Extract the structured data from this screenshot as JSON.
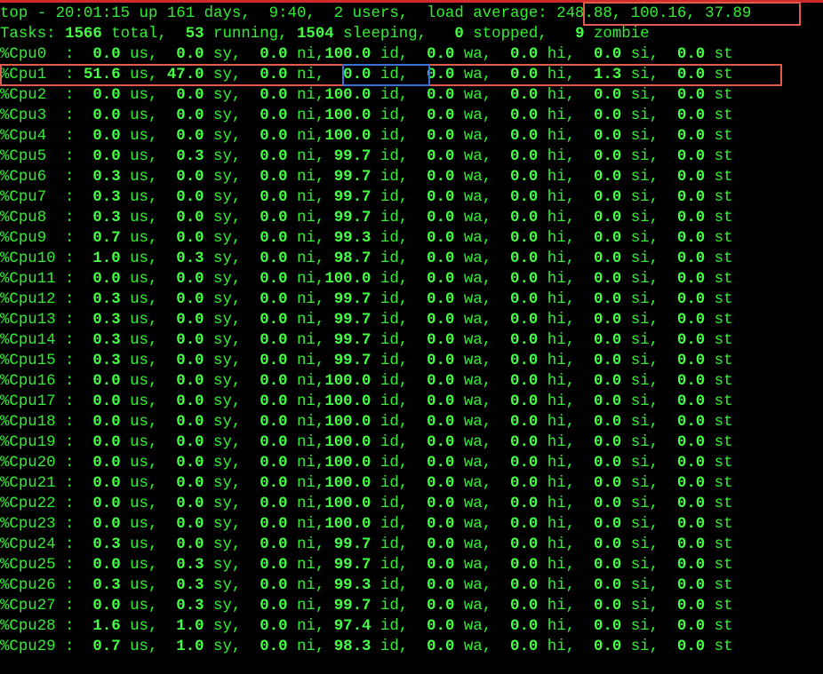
{
  "terminal": {
    "summary_top": {
      "prefix": "top - 20:01:15 up 161 days,  9:40,  2 users,  load average: ",
      "load_average": "248.88, 100.16, 37.89"
    },
    "tasks": {
      "label": "Tasks: ",
      "total": "1566",
      "total_label": " total,  ",
      "running": "53",
      "running_label": " running, ",
      "sleeping": "1504",
      "sleeping_label": " sleeping,   ",
      "stopped": "0",
      "stopped_label": " stopped,   ",
      "zombie": "9",
      "zombie_label": " zombie"
    },
    "cpus": [
      {
        "name": "%Cpu0  : ",
        "us": " 0.0",
        "sy": " 0.0",
        "ni": " 0.0",
        "ni_sep": " ni,",
        "id": "100.0",
        "wa": " 0.0",
        "hi": " 0.0",
        "si": " 0.0",
        "st": " 0.0"
      },
      {
        "name": "%Cpu1  : ",
        "us": "51.6",
        "sy": "47.0",
        "ni": " 0.0",
        "ni_sep": " ni, ",
        "id": " 0.0",
        "wa": " 0.0",
        "hi": " 0.0",
        "si": " 1.3",
        "st": " 0.0"
      },
      {
        "name": "%Cpu2  : ",
        "us": " 0.0",
        "sy": " 0.0",
        "ni": " 0.0",
        "ni_sep": " ni,",
        "id": "100.0",
        "wa": " 0.0",
        "hi": " 0.0",
        "si": " 0.0",
        "st": " 0.0"
      },
      {
        "name": "%Cpu3  : ",
        "us": " 0.0",
        "sy": " 0.0",
        "ni": " 0.0",
        "ni_sep": " ni,",
        "id": "100.0",
        "wa": " 0.0",
        "hi": " 0.0",
        "si": " 0.0",
        "st": " 0.0"
      },
      {
        "name": "%Cpu4  : ",
        "us": " 0.0",
        "sy": " 0.0",
        "ni": " 0.0",
        "ni_sep": " ni,",
        "id": "100.0",
        "wa": " 0.0",
        "hi": " 0.0",
        "si": " 0.0",
        "st": " 0.0"
      },
      {
        "name": "%Cpu5  : ",
        "us": " 0.0",
        "sy": " 0.3",
        "ni": " 0.0",
        "ni_sep": " ni, ",
        "id": "99.7",
        "wa": " 0.0",
        "hi": " 0.0",
        "si": " 0.0",
        "st": " 0.0"
      },
      {
        "name": "%Cpu6  : ",
        "us": " 0.3",
        "sy": " 0.0",
        "ni": " 0.0",
        "ni_sep": " ni, ",
        "id": "99.7",
        "wa": " 0.0",
        "hi": " 0.0",
        "si": " 0.0",
        "st": " 0.0"
      },
      {
        "name": "%Cpu7  : ",
        "us": " 0.3",
        "sy": " 0.0",
        "ni": " 0.0",
        "ni_sep": " ni, ",
        "id": "99.7",
        "wa": " 0.0",
        "hi": " 0.0",
        "si": " 0.0",
        "st": " 0.0"
      },
      {
        "name": "%Cpu8  : ",
        "us": " 0.3",
        "sy": " 0.0",
        "ni": " 0.0",
        "ni_sep": " ni, ",
        "id": "99.7",
        "wa": " 0.0",
        "hi": " 0.0",
        "si": " 0.0",
        "st": " 0.0"
      },
      {
        "name": "%Cpu9  : ",
        "us": " 0.7",
        "sy": " 0.0",
        "ni": " 0.0",
        "ni_sep": " ni, ",
        "id": "99.3",
        "wa": " 0.0",
        "hi": " 0.0",
        "si": " 0.0",
        "st": " 0.0"
      },
      {
        "name": "%Cpu10 : ",
        "us": " 1.0",
        "sy": " 0.3",
        "ni": " 0.0",
        "ni_sep": " ni, ",
        "id": "98.7",
        "wa": " 0.0",
        "hi": " 0.0",
        "si": " 0.0",
        "st": " 0.0"
      },
      {
        "name": "%Cpu11 : ",
        "us": " 0.0",
        "sy": " 0.0",
        "ni": " 0.0",
        "ni_sep": " ni,",
        "id": "100.0",
        "wa": " 0.0",
        "hi": " 0.0",
        "si": " 0.0",
        "st": " 0.0"
      },
      {
        "name": "%Cpu12 : ",
        "us": " 0.3",
        "sy": " 0.0",
        "ni": " 0.0",
        "ni_sep": " ni, ",
        "id": "99.7",
        "wa": " 0.0",
        "hi": " 0.0",
        "si": " 0.0",
        "st": " 0.0"
      },
      {
        "name": "%Cpu13 : ",
        "us": " 0.3",
        "sy": " 0.0",
        "ni": " 0.0",
        "ni_sep": " ni, ",
        "id": "99.7",
        "wa": " 0.0",
        "hi": " 0.0",
        "si": " 0.0",
        "st": " 0.0"
      },
      {
        "name": "%Cpu14 : ",
        "us": " 0.3",
        "sy": " 0.0",
        "ni": " 0.0",
        "ni_sep": " ni, ",
        "id": "99.7",
        "wa": " 0.0",
        "hi": " 0.0",
        "si": " 0.0",
        "st": " 0.0"
      },
      {
        "name": "%Cpu15 : ",
        "us": " 0.3",
        "sy": " 0.0",
        "ni": " 0.0",
        "ni_sep": " ni, ",
        "id": "99.7",
        "wa": " 0.0",
        "hi": " 0.0",
        "si": " 0.0",
        "st": " 0.0"
      },
      {
        "name": "%Cpu16 : ",
        "us": " 0.0",
        "sy": " 0.0",
        "ni": " 0.0",
        "ni_sep": " ni,",
        "id": "100.0",
        "wa": " 0.0",
        "hi": " 0.0",
        "si": " 0.0",
        "st": " 0.0"
      },
      {
        "name": "%Cpu17 : ",
        "us": " 0.0",
        "sy": " 0.0",
        "ni": " 0.0",
        "ni_sep": " ni,",
        "id": "100.0",
        "wa": " 0.0",
        "hi": " 0.0",
        "si": " 0.0",
        "st": " 0.0"
      },
      {
        "name": "%Cpu18 : ",
        "us": " 0.0",
        "sy": " 0.0",
        "ni": " 0.0",
        "ni_sep": " ni,",
        "id": "100.0",
        "wa": " 0.0",
        "hi": " 0.0",
        "si": " 0.0",
        "st": " 0.0"
      },
      {
        "name": "%Cpu19 : ",
        "us": " 0.0",
        "sy": " 0.0",
        "ni": " 0.0",
        "ni_sep": " ni,",
        "id": "100.0",
        "wa": " 0.0",
        "hi": " 0.0",
        "si": " 0.0",
        "st": " 0.0"
      },
      {
        "name": "%Cpu20 : ",
        "us": " 0.0",
        "sy": " 0.0",
        "ni": " 0.0",
        "ni_sep": " ni,",
        "id": "100.0",
        "wa": " 0.0",
        "hi": " 0.0",
        "si": " 0.0",
        "st": " 0.0"
      },
      {
        "name": "%Cpu21 : ",
        "us": " 0.0",
        "sy": " 0.0",
        "ni": " 0.0",
        "ni_sep": " ni,",
        "id": "100.0",
        "wa": " 0.0",
        "hi": " 0.0",
        "si": " 0.0",
        "st": " 0.0"
      },
      {
        "name": "%Cpu22 : ",
        "us": " 0.0",
        "sy": " 0.0",
        "ni": " 0.0",
        "ni_sep": " ni,",
        "id": "100.0",
        "wa": " 0.0",
        "hi": " 0.0",
        "si": " 0.0",
        "st": " 0.0"
      },
      {
        "name": "%Cpu23 : ",
        "us": " 0.0",
        "sy": " 0.0",
        "ni": " 0.0",
        "ni_sep": " ni,",
        "id": "100.0",
        "wa": " 0.0",
        "hi": " 0.0",
        "si": " 0.0",
        "st": " 0.0"
      },
      {
        "name": "%Cpu24 : ",
        "us": " 0.3",
        "sy": " 0.0",
        "ni": " 0.0",
        "ni_sep": " ni, ",
        "id": "99.7",
        "wa": " 0.0",
        "hi": " 0.0",
        "si": " 0.0",
        "st": " 0.0"
      },
      {
        "name": "%Cpu25 : ",
        "us": " 0.0",
        "sy": " 0.3",
        "ni": " 0.0",
        "ni_sep": " ni, ",
        "id": "99.7",
        "wa": " 0.0",
        "hi": " 0.0",
        "si": " 0.0",
        "st": " 0.0"
      },
      {
        "name": "%Cpu26 : ",
        "us": " 0.3",
        "sy": " 0.3",
        "ni": " 0.0",
        "ni_sep": " ni, ",
        "id": "99.3",
        "wa": " 0.0",
        "hi": " 0.0",
        "si": " 0.0",
        "st": " 0.0"
      },
      {
        "name": "%Cpu27 : ",
        "us": " 0.0",
        "sy": " 0.3",
        "ni": " 0.0",
        "ni_sep": " ni, ",
        "id": "99.7",
        "wa": " 0.0",
        "hi": " 0.0",
        "si": " 0.0",
        "st": " 0.0"
      },
      {
        "name": "%Cpu28 : ",
        "us": " 1.6",
        "sy": " 1.0",
        "ni": " 0.0",
        "ni_sep": " ni, ",
        "id": "97.4",
        "wa": " 0.0",
        "hi": " 0.0",
        "si": " 0.0",
        "st": " 0.0"
      },
      {
        "name": "%Cpu29 : ",
        "us": " 0.7",
        "sy": " 1.0",
        "ni": " 0.0",
        "ni_sep": " ni, ",
        "id": "98.3",
        "wa": " 0.0",
        "hi": " 0.0",
        "si": " 0.0",
        "st": " 0.0"
      }
    ],
    "field_labels": {
      "us": " us, ",
      "sy": " sy, ",
      "id": " id, ",
      "wa": " wa, ",
      "hi": " hi, ",
      "si": " si, ",
      "st": " st"
    },
    "colors": {
      "background": "#000000",
      "text": "#33ee33",
      "highlight_red": "#e35a4a",
      "highlight_blue": "#3a6fd8"
    }
  }
}
